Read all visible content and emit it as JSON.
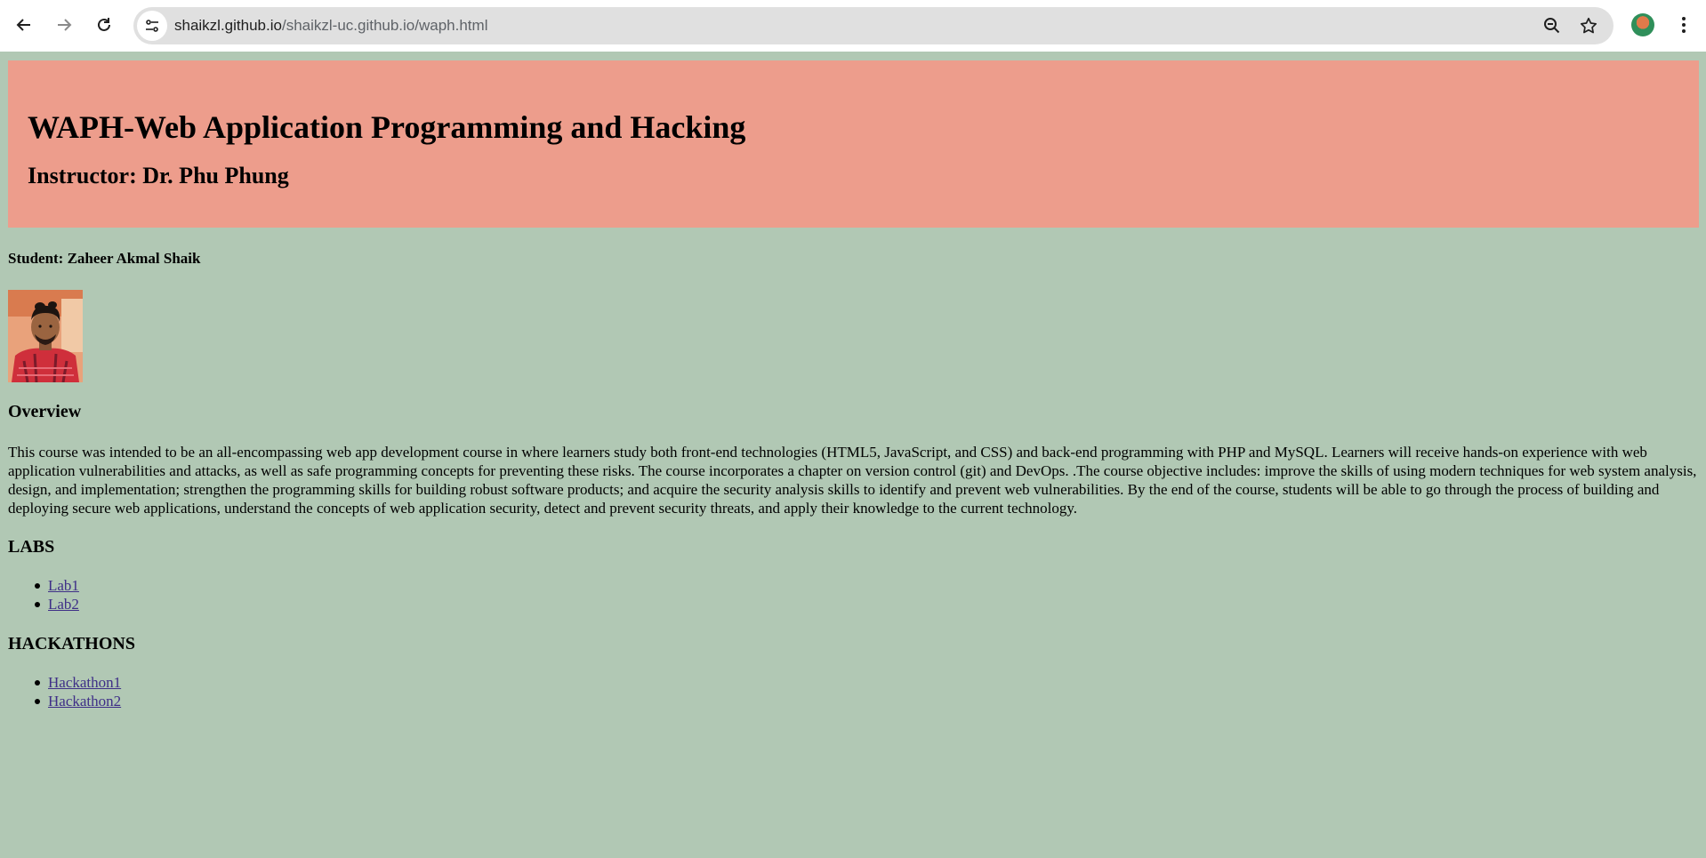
{
  "browser": {
    "url_host": "shaikzl.github.io",
    "url_path": "/shaikzl-uc.github.io/waph.html"
  },
  "page": {
    "title": "WAPH-Web Application Programming and Hacking",
    "instructor": "Instructor: Dr. Phu Phung",
    "student": "Student: Zaheer Akmal Shaik",
    "overview_heading": "Overview",
    "overview_text": "This course was intended to be an all-encompassing web app development course in where learners study both front-end technologies (HTML5, JavaScript, and CSS) and back-end programming with PHP and MySQL. Learners will receive hands-on experience with web application vulnerabilities and attacks, as well as safe programming concepts for preventing these risks. The course incorporates a chapter on version control (git) and DevOps. .The course objective includes: improve the skills of using modern techniques for web system analysis, design, and implementation; strengthen the programming skills for building robust software products; and acquire the security analysis skills to identify and prevent web vulnerabilities. By the end of the course, students will be able to go through the process of building and deploying secure web applications, understand the concepts of web application security, detect and prevent security threats, and apply their knowledge to the current technology.",
    "labs_heading": "LABS",
    "labs": [
      {
        "label": "Lab1"
      },
      {
        "label": "Lab2"
      }
    ],
    "hackathons_heading": "HACKATHONS",
    "hackathons": [
      {
        "label": "Hackathon1"
      },
      {
        "label": "Hackathon2"
      }
    ]
  },
  "colors": {
    "page_background": "#b1c8b4",
    "header_background": "#ed9d8c",
    "link": "#3e2e87"
  },
  "icons": {
    "back": "arrow-left-icon",
    "forward": "arrow-right-icon",
    "reload": "reload-icon",
    "site_info": "tune-icon",
    "zoom": "zoom-out-icon",
    "bookmark": "star-icon",
    "menu": "kebab-menu-icon"
  }
}
